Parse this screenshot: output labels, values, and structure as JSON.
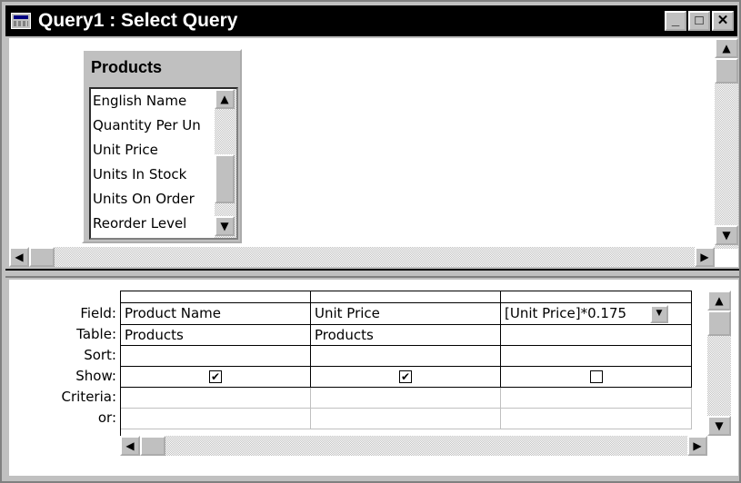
{
  "window": {
    "title": "Query1 : Select Query",
    "buttons": {
      "minimize": "_",
      "maximize": "□",
      "close": "✕"
    }
  },
  "table_box": {
    "title": "Products",
    "fields": [
      "English Name",
      "Quantity Per Un",
      "Unit Price",
      "Units In Stock",
      "Units On Order",
      "Reorder Level"
    ]
  },
  "design_grid": {
    "row_labels": {
      "field": "Field:",
      "table": "Table:",
      "sort": "Sort:",
      "show": "Show:",
      "criteria": "Criteria:",
      "or": "or:"
    },
    "columns": [
      {
        "field": "Product Name",
        "table": "Products",
        "show": true
      },
      {
        "field": "Unit Price",
        "table": "Products",
        "show": true
      },
      {
        "field": "[Unit Price]*0.175",
        "table": "",
        "show": false
      }
    ]
  },
  "icons": {
    "scroll_up": "▲",
    "scroll_down": "▼",
    "scroll_left": "◀",
    "scroll_right": "▶",
    "dropdown": "▼",
    "check": "✔"
  }
}
